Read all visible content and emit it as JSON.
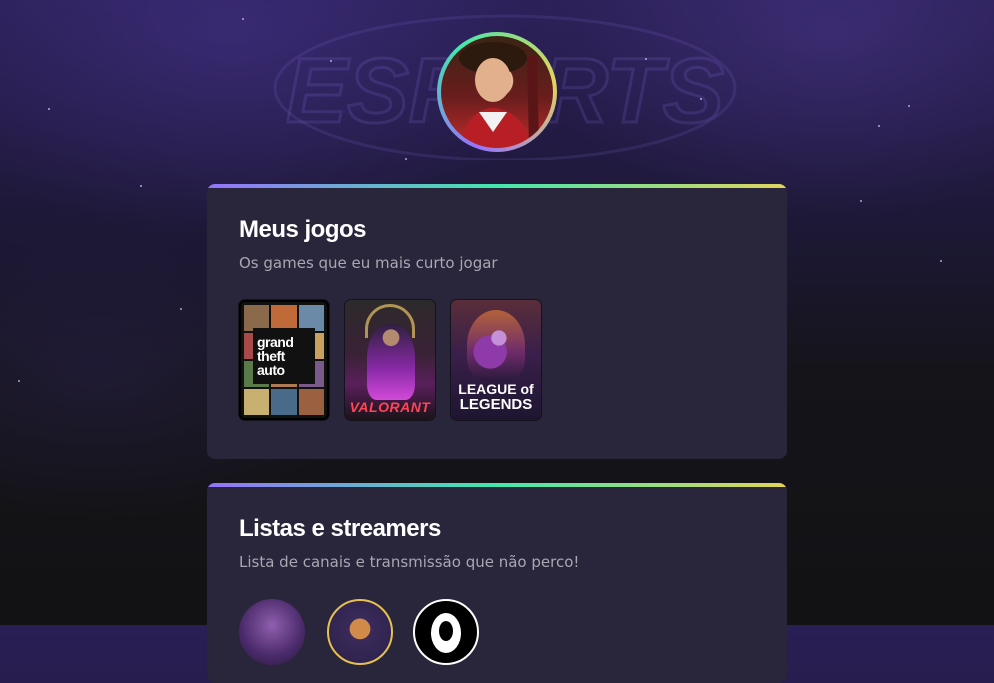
{
  "profile": {
    "avatar": "profile-photo",
    "background_logo_text": "ESPORTS"
  },
  "colors": {
    "accent_gradient": [
      "#9572fc",
      "#43e7ad",
      "#e2d45c"
    ],
    "card_bg": "#29253a",
    "subtitle": "#a8a8b3"
  },
  "sections": {
    "games": {
      "title": "Meus jogos",
      "subtitle": "Os games que eu mais curto jogar",
      "items": [
        {
          "name": "Grand Theft Auto V",
          "logo_lines": [
            "grand",
            "theft",
            "auto"
          ]
        },
        {
          "name": "VALORANT",
          "logo_text": "VALORANT"
        },
        {
          "name": "League of Legends",
          "logo_lines": [
            "LEAGUE of",
            "LEGENDS"
          ]
        }
      ]
    },
    "streamers": {
      "title": "Listas e streamers",
      "subtitle": "Lista de canais e transmissão que não perco!",
      "items": [
        {
          "name": "streamer-1"
        },
        {
          "name": "streamer-2"
        },
        {
          "name": "streamer-3"
        }
      ]
    }
  }
}
